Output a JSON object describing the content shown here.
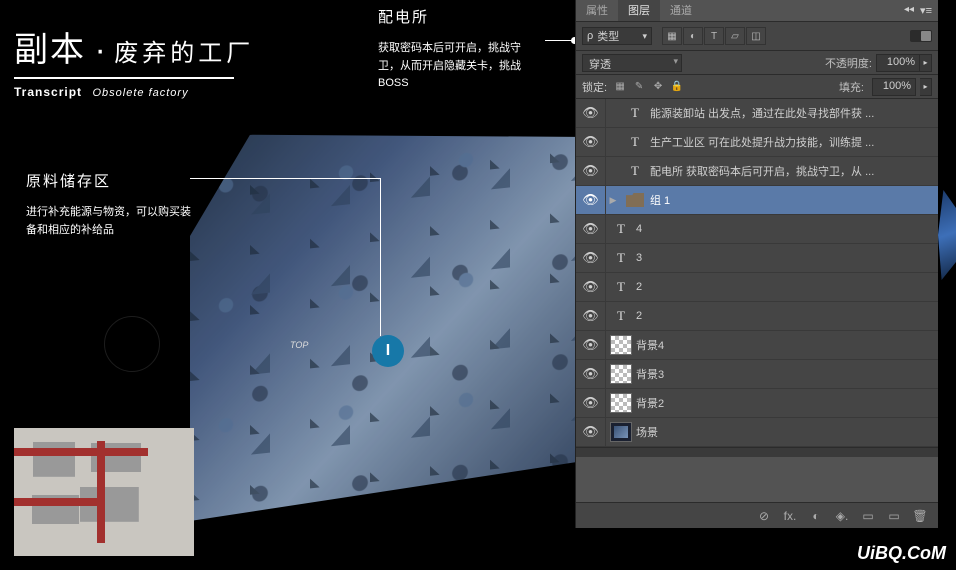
{
  "title": {
    "main": "副本",
    "dot": "·",
    "sub": "废弃的工厂",
    "en1": "Transcript",
    "en2": "Obsolete factory"
  },
  "callouts": {
    "c1": {
      "title": "配电所",
      "body": "获取密码本后可开启，挑战守卫，从而开启隐藏关卡，挑战BOSS"
    },
    "c2": {
      "title": "原料储存区",
      "body": "进行补充能源与物资，可以购买装备和相应的补给品"
    }
  },
  "marker": "I",
  "scene_tag": "TOP",
  "watermark": "UiBQ.CoM",
  "panel": {
    "tabs": {
      "t1": "属性",
      "t2": "图层",
      "t3": "通道"
    },
    "filter": {
      "kind_label": "类型",
      "search_icon": "ρ"
    },
    "blend": {
      "mode": "穿透",
      "opacity_label": "不透明度:",
      "opacity": "100%"
    },
    "lock": {
      "label": "锁定:",
      "fill_label": "填充:",
      "fill": "100%"
    },
    "layers": [
      {
        "vis": true,
        "type": "text",
        "name": "能源装卸站  出发点，通过在此处寻找部件获 ...",
        "indent": 1
      },
      {
        "vis": true,
        "type": "text",
        "name": "生产工业区  可在此处提升战力技能，训练提 ...",
        "indent": 1
      },
      {
        "vis": true,
        "type": "text",
        "name": "配电所  获取密码本后可开启，挑战守卫，从 ...",
        "indent": 1
      },
      {
        "vis": true,
        "type": "folder",
        "name": "组 1",
        "indent": 0,
        "selected": true,
        "expand": "▶"
      },
      {
        "vis": true,
        "type": "text",
        "name": "4",
        "indent": 0
      },
      {
        "vis": true,
        "type": "text",
        "name": "3",
        "indent": 0
      },
      {
        "vis": true,
        "type": "text",
        "name": "2",
        "indent": 0
      },
      {
        "vis": true,
        "type": "text",
        "name": "2",
        "indent": 0
      },
      {
        "vis": true,
        "type": "checker",
        "name": "背景4",
        "indent": 0
      },
      {
        "vis": true,
        "type": "checker",
        "name": "背景3",
        "indent": 0
      },
      {
        "vis": true,
        "type": "checker",
        "name": "背景2",
        "indent": 0
      },
      {
        "vis": true,
        "type": "img",
        "name": "场景",
        "indent": 0
      }
    ],
    "footer_icons": [
      "⊘",
      "fx.",
      "◐",
      "◈.",
      "▭",
      "▭",
      "🗑"
    ]
  }
}
